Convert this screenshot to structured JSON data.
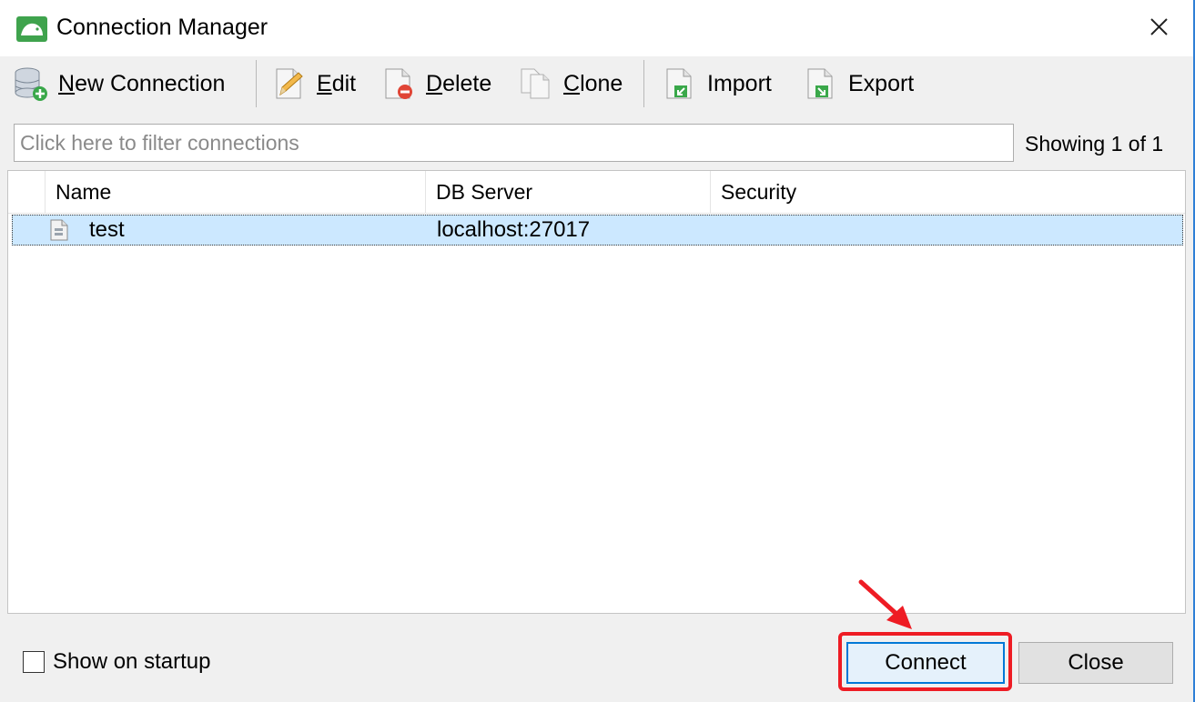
{
  "window": {
    "title": "Connection Manager",
    "accent_color": "#0078d7"
  },
  "toolbar": {
    "new_connection": {
      "mnemonic": "N",
      "rest": "ew Connection",
      "icon": "database-add-icon"
    },
    "edit": {
      "mnemonic": "E",
      "rest": "dit",
      "icon": "pencil-document-icon"
    },
    "delete": {
      "mnemonic": "D",
      "rest": "elete",
      "icon": "document-delete-icon"
    },
    "clone": {
      "mnemonic": "C",
      "rest": "lone",
      "icon": "documents-copy-icon"
    },
    "import": {
      "label": "Import",
      "icon": "document-import-icon"
    },
    "export": {
      "label": "Export",
      "icon": "document-export-icon"
    }
  },
  "filter": {
    "placeholder": "Click here to filter connections",
    "value": "",
    "status": "Showing 1 of 1"
  },
  "list": {
    "columns": [
      "Name",
      "DB Server",
      "Security"
    ],
    "rows": [
      {
        "name": "test",
        "server": "localhost:27017",
        "security": "",
        "selected": true
      }
    ]
  },
  "footer": {
    "show_on_startup_label": "Show on startup",
    "show_on_startup_checked": false,
    "connect_label": "Connect",
    "close_label": "Close",
    "highlight_color": "#ee1c24"
  }
}
